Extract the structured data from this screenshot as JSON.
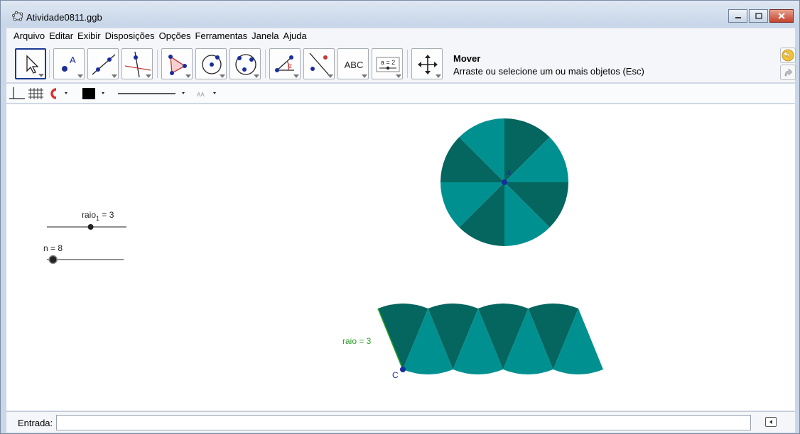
{
  "window": {
    "title": "Atividade0811.ggb"
  },
  "menu": [
    "Arquivo",
    "Editar",
    "Exibir",
    "Disposições",
    "Opções",
    "Ferramentas",
    "Janela",
    "Ajuda"
  ],
  "toolbar": {
    "tools": [
      {
        "name": "move-tool",
        "label": ""
      },
      {
        "name": "point-tool",
        "label": "A"
      },
      {
        "name": "line-tool",
        "label": ""
      },
      {
        "name": "perpendicular-tool",
        "label": ""
      },
      {
        "name": "polygon-tool",
        "label": ""
      },
      {
        "name": "circle-tool",
        "label": ""
      },
      {
        "name": "conic-tool",
        "label": ""
      },
      {
        "name": "angle-tool",
        "label": "α"
      },
      {
        "name": "reflect-tool",
        "label": ""
      },
      {
        "name": "text-tool",
        "label": "ABC"
      },
      {
        "name": "slider-tool",
        "label": "a = 2"
      },
      {
        "name": "move-graphics-tool",
        "label": ""
      }
    ],
    "active_title": "Mover",
    "active_help": "Arraste ou selecione um ou mais objetos (Esc)"
  },
  "graphics": {
    "slider_raio1": {
      "label_base": "raio",
      "label_sub": "1",
      "label_value": " = 3",
      "value": 3,
      "fraction": 0.55
    },
    "slider_n": {
      "label": "n = 8",
      "value": 8,
      "fraction": 0.08
    },
    "circle": {
      "center_label": "A",
      "sectors": 8,
      "color_dark": "#05655f",
      "color_light": "#009090"
    },
    "strip": {
      "segment_label": "raio = 3",
      "point_label": "C",
      "segment_color": "#2a9d2a",
      "pieces": 8
    },
    "point_color": "#1a2d9c"
  },
  "input": {
    "label": "Entrada:",
    "value": ""
  }
}
